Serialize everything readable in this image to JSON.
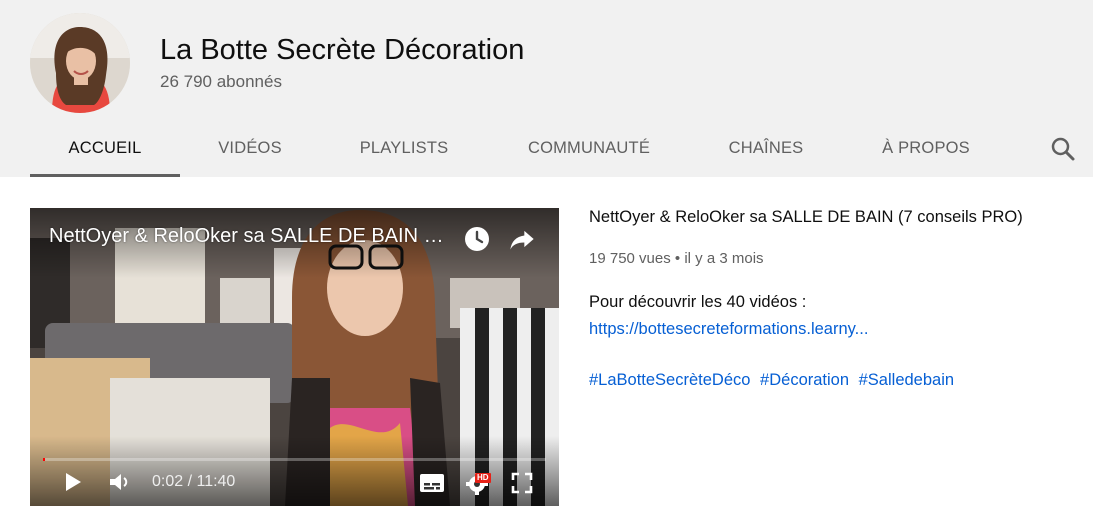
{
  "channel": {
    "name": "La Botte Secrète Décoration",
    "subscribers": "26 790 abonnés"
  },
  "tabs": [
    {
      "label": "ACCUEIL",
      "active": true
    },
    {
      "label": "VIDÉOS",
      "active": false
    },
    {
      "label": "PLAYLISTS",
      "active": false
    },
    {
      "label": "COMMUNAUTÉ",
      "active": false
    },
    {
      "label": "CHAÎNES",
      "active": false
    },
    {
      "label": "À PROPOS",
      "active": false
    }
  ],
  "search": {
    "icon": "search-icon"
  },
  "player": {
    "title": "NettOyer & ReloOker sa SALLE DE BAIN (7 conseils PRO)",
    "time": "0:02 / 11:40",
    "progress_fraction": 0.003,
    "icons": {
      "watch_later": "clock-icon",
      "share": "share-icon",
      "play": "play-icon",
      "volume": "volume-icon",
      "captions": "subtitles-icon",
      "settings": "gear-icon",
      "fullscreen": "fullscreen-icon"
    },
    "hd_badge": "HD"
  },
  "video": {
    "title": "NettOyer & ReloOker sa SALLE DE BAIN (7 conseils PRO)",
    "views": "19 750 vues",
    "separator": "•",
    "age": "il y a 3 mois",
    "description": "Pour découvrir les 40 vidéos :",
    "link": "https://bottesecreteformations.learny...",
    "hashtags": [
      "#LaBotteSecrèteDéco",
      "#Décoration",
      "#Salledebain"
    ]
  },
  "colors": {
    "header_bg": "#f1f1f1",
    "link": "#065fd4",
    "progress": "#ff0000",
    "hd_badge": "#e62117"
  }
}
